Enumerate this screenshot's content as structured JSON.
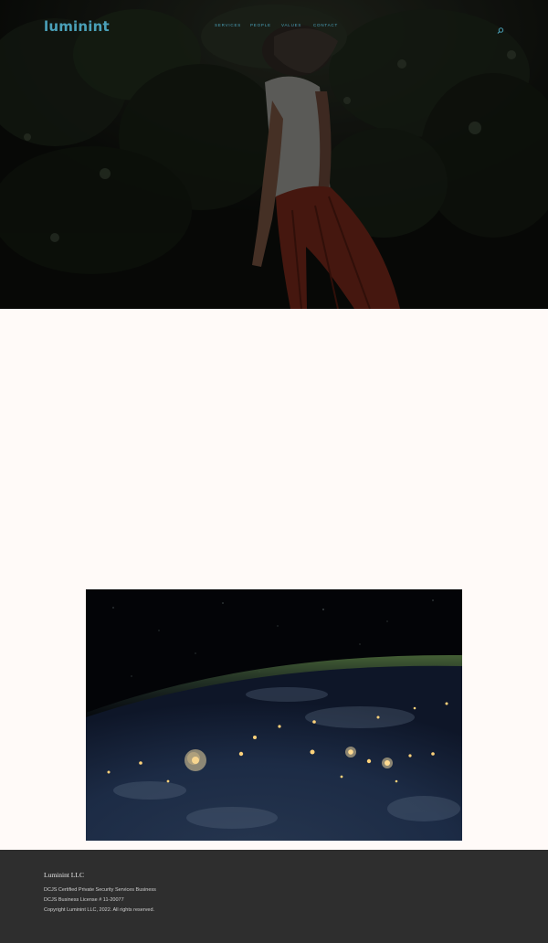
{
  "header": {
    "logo": "luminint",
    "nav": [
      {
        "label": "SERVICES"
      },
      {
        "label": "PEOPLE"
      },
      {
        "label": "VALUES"
      },
      {
        "label": "CONTACT"
      }
    ],
    "search_icon": "search-icon",
    "accent_color": "#4aa0b8"
  },
  "hero": {
    "image": "photo-woman-jumping-forest-dusk"
  },
  "feature_image": {
    "image": "photo-earth-city-lights-from-space"
  },
  "footer": {
    "title": "Luminint LLC",
    "lines": [
      "DCJS Certified Private Security Services Business",
      "DCJS Business License # 11-20077",
      "Copyright Luminint LLC, 2022.  All rights reserved."
    ],
    "background": "#2e2e2e"
  }
}
